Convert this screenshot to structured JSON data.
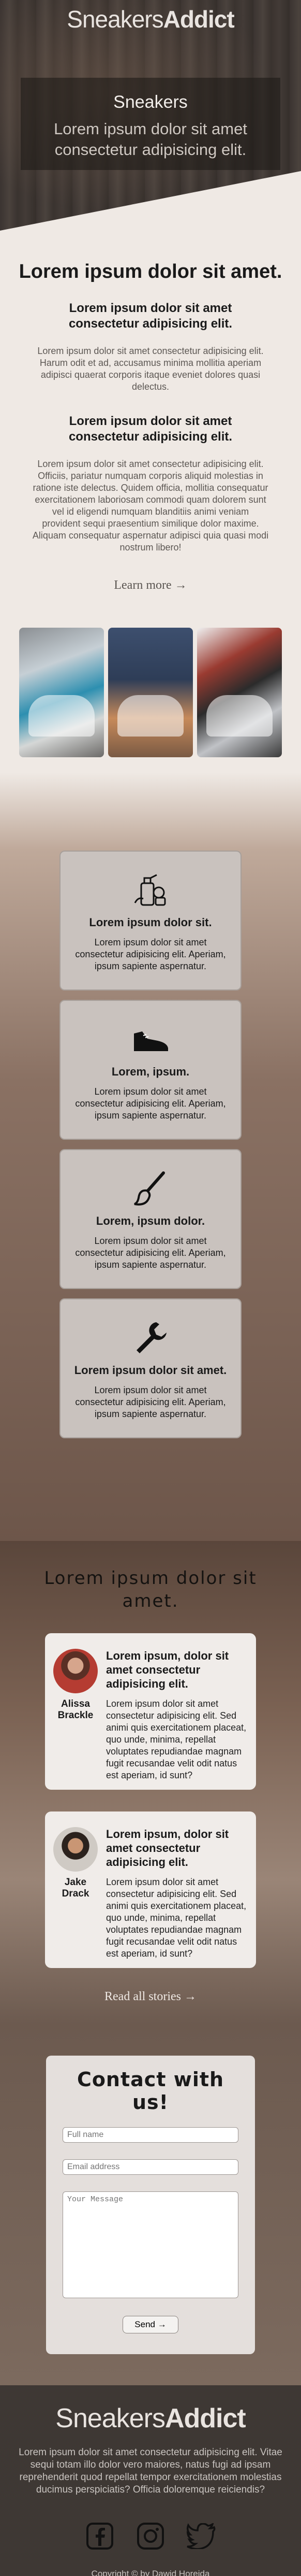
{
  "header": {
    "brand_part1": "Sneakers",
    "brand_part2": "Addict",
    "hero_title": "Sneakers",
    "hero_subtitle": "Lorem ipsum dolor sit amet consectetur adipisicing elit."
  },
  "intro": {
    "title": "Lorem ipsum dolor sit amet.",
    "block1_heading": "Lorem ipsum dolor sit amet consectetur adipisicing elit.",
    "block1_text": "Lorem ipsum dolor sit amet consectetur adipisicing elit. Harum odit et ad, accusamus minima mollitia aperiam adipisci quaerat corporis itaque eveniet dolores quasi delectus.",
    "block2_heading": "Lorem ipsum dolor sit amet consectetur adipisicing elit.",
    "block2_text": "Lorem ipsum dolor sit amet consectetur adipisicing elit. Officiis, pariatur numquam corporis aliquid molestias in ratione iste delectus. Quidem officia, mollitia consequatur exercitationem laboriosam commodi quam dolorem sunt vel id eligendi numquam blanditiis animi veniam provident sequi praesentium similique dolor maxime. Aliquam consequatur aspernatur adipisci quia quasi modi nostrum libero!",
    "more_link": "Learn more →"
  },
  "features": [
    {
      "icon": "sneaker-care-icon",
      "title": "Lorem ipsum dolor sit.",
      "text": "Lorem ipsum dolor sit amet consectetur adipisicing elit. Aperiam, ipsum sapiente aspernatur."
    },
    {
      "icon": "sneaker-icon",
      "title": "Lorem, ipsum.",
      "text": "Lorem ipsum dolor sit amet consectetur adipisicing elit. Aperiam, ipsum sapiente aspernatur."
    },
    {
      "icon": "brush-icon",
      "title": "Lorem, ipsum dolor.",
      "text": "Lorem ipsum dolor sit amet consectetur adipisicing elit. Aperiam, ipsum sapiente aspernatur."
    },
    {
      "icon": "wrench-icon",
      "title": "Lorem ipsum dolor sit amet.",
      "text": "Lorem ipsum dolor sit amet consectetur adipisicing elit. Aperiam, ipsum sapiente aspernatur."
    }
  ],
  "stories": {
    "title": "Lorem ipsum dolor sit amet.",
    "items": [
      {
        "name": "Alissa Brackle",
        "heading": "Lorem ipsum, dolor sit amet consectetur adipisicing elit.",
        "text": "Lorem ipsum dolor sit amet consectetur adipisicing elit. Sed animi quis exercitationem placeat, quo unde, minima, repellat voluptates repudiandae magnam fugit recusandae velit odit natus est aperiam, id sunt?"
      },
      {
        "name": "Jake Drack",
        "heading": "Lorem ipsum, dolor sit amet consectetur adipisicing elit.",
        "text": "Lorem ipsum dolor sit amet consectetur adipisicing elit. Sed animi quis exercitationem placeat, quo unde, minima, repellat voluptates repudiandae magnam fugit recusandae velit odit natus est aperiam, id sunt?"
      }
    ],
    "all_link": "Read all stories →"
  },
  "contact": {
    "title": "Contact with us!",
    "name_placeholder": "Full name",
    "email_placeholder": "Email address",
    "message_placeholder": "Your Message",
    "send_label": "Send →"
  },
  "footer": {
    "brand_part1": "Sneakers",
    "brand_part2": "Addict",
    "text": "Lorem ipsum dolor sit amet consectetur adipisicing elit. Vitae sequi totam illo dolor vero maiores, natus fugi ad ipsam reprehenderit quod repellat tempor exercitationem molestias ducimus perspiciatis? Officia doloremque reiciendis?",
    "socials": [
      "facebook-icon",
      "instagram-icon",
      "twitter-icon"
    ],
    "copyright": "Copyright © by Dawid Horejda"
  }
}
